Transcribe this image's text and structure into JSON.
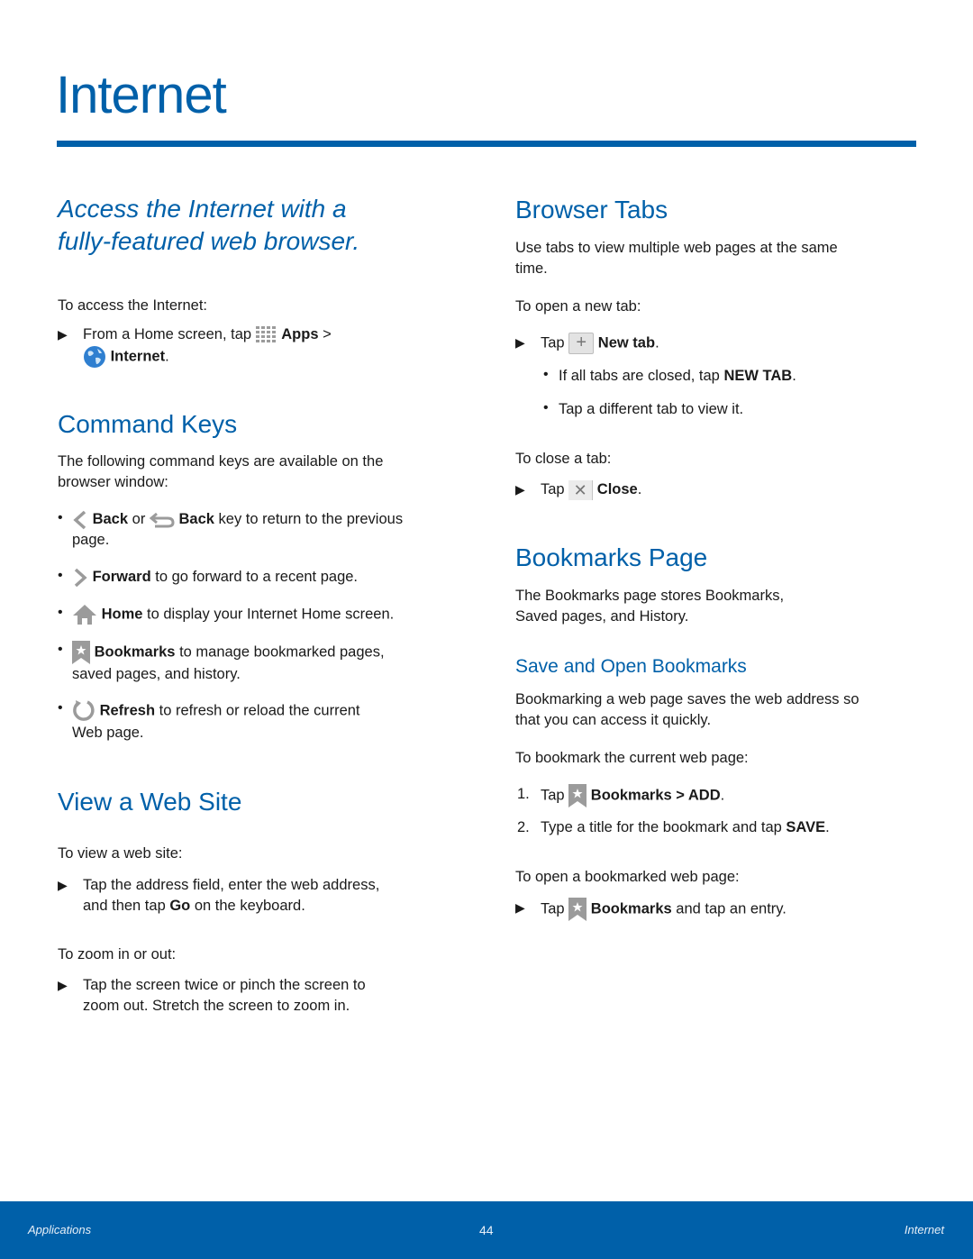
{
  "page_title": "Internet",
  "intro": {
    "line1": "Access the Internet with a",
    "line2": "fully-featured web browser."
  },
  "access": {
    "lead": "To access the Internet:",
    "step_a": "From a Home screen, tap",
    "apps": "Apps",
    "gt": ">",
    "internet": "Internet",
    "period": "."
  },
  "command_keys": {
    "heading": "Command Keys",
    "desc_line1": "The following command keys are available on the",
    "desc_line2": "browser window:",
    "items": [
      {
        "bold": "Back",
        "mid": "or",
        "bold2": "Back",
        "text": "key to return to the previous",
        "text2": "page."
      },
      {
        "bold": "Forward",
        "text": "to go forward to a recent page."
      },
      {
        "bold": "Home",
        "text": "to display your Internet Home screen."
      },
      {
        "bold": "Bookmarks",
        "text": "to manage bookmarked pages,",
        "text2": "saved pages, and history."
      },
      {
        "bold": "Refresh",
        "text": "to refresh or reload the current",
        "text2": "Web page."
      }
    ]
  },
  "view_site": {
    "heading": "View a Web Site",
    "lead": "To view a web site:",
    "step1_line1": "Tap the address field, enter the web address,",
    "step1_pre": "and then tap",
    "step1_bold": "Go",
    "step1_post": "on the keyboard.",
    "zoom_lead": "To zoom in or out:",
    "step2_line1": "Tap the screen twice or pinch the screen to",
    "step2_line2": "zoom out. Stretch the screen to zoom in."
  },
  "browser_tabs": {
    "heading": "Browser Tabs",
    "desc_line1": "Use tabs to view multiple web pages at the same",
    "desc_line2": "time.",
    "open_lead": "To open a new tab:",
    "tap": "Tap",
    "new_tab": "New tab",
    "sub1_pre": "If all tabs are closed, tap",
    "sub1_bold": "NEW TAB",
    "sub2": "Tap a different tab to view it.",
    "close_lead": "To close a tab:",
    "close": "Close",
    "period": "."
  },
  "bookmarks_page": {
    "heading": "Bookmarks Page",
    "desc_line1": "The Bookmarks page stores Bookmarks,",
    "desc_line2": "Saved pages, and History.",
    "subheading": "Save and Open Bookmarks",
    "sub_desc_line1": "Bookmarking a web page saves the web address so",
    "sub_desc_line2": "that you can access it quickly.",
    "bookmark_lead": "To bookmark the current web page:",
    "step1_num": "1.",
    "step1_pre": "Tap",
    "step1_bold": "Bookmarks > ADD",
    "step2_num": "2.",
    "step2_pre": "Type a title for the bookmark and tap",
    "step2_bold": "SAVE",
    "open_lead": "To open a bookmarked web page:",
    "open_pre": "Tap",
    "open_bold": "Bookmarks",
    "open_post": "and tap an entry."
  },
  "footer": {
    "left": "Applications",
    "page_number": "44",
    "right": "Internet"
  },
  "colors": {
    "accent": "#0060a9",
    "icon_gray": "#9b9b9b"
  }
}
